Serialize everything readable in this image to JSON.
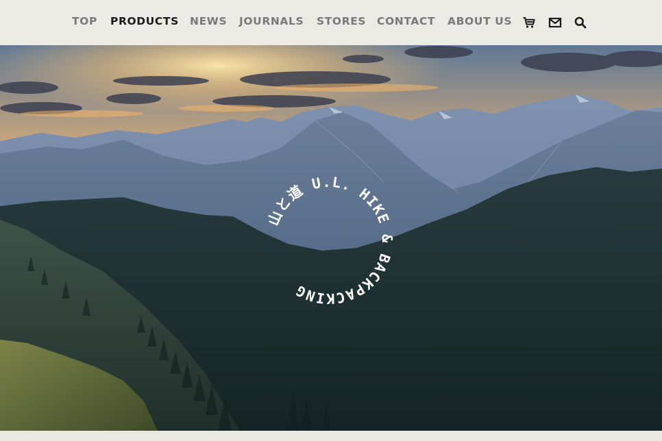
{
  "nav": {
    "items": [
      {
        "label": "TOP",
        "active": false
      },
      {
        "label": "PRODUCTS",
        "active": true
      },
      {
        "label": "NEWS",
        "active": false
      },
      {
        "label": "JOURNALS",
        "active": false
      },
      {
        "label": "STORES",
        "active": false
      },
      {
        "label": "CONTACT",
        "active": false
      },
      {
        "label": "ABOUT US",
        "active": false
      }
    ],
    "icons": [
      "cart-icon",
      "mail-icon",
      "search-icon"
    ]
  },
  "hero": {
    "logo_text": "山と道 U.L. HIKE & BACKPACKING"
  },
  "colors": {
    "nav_bg": "#eceae5",
    "nav_text": "#797979",
    "nav_active": "#1b1b1b",
    "logo": "#ffffff"
  }
}
